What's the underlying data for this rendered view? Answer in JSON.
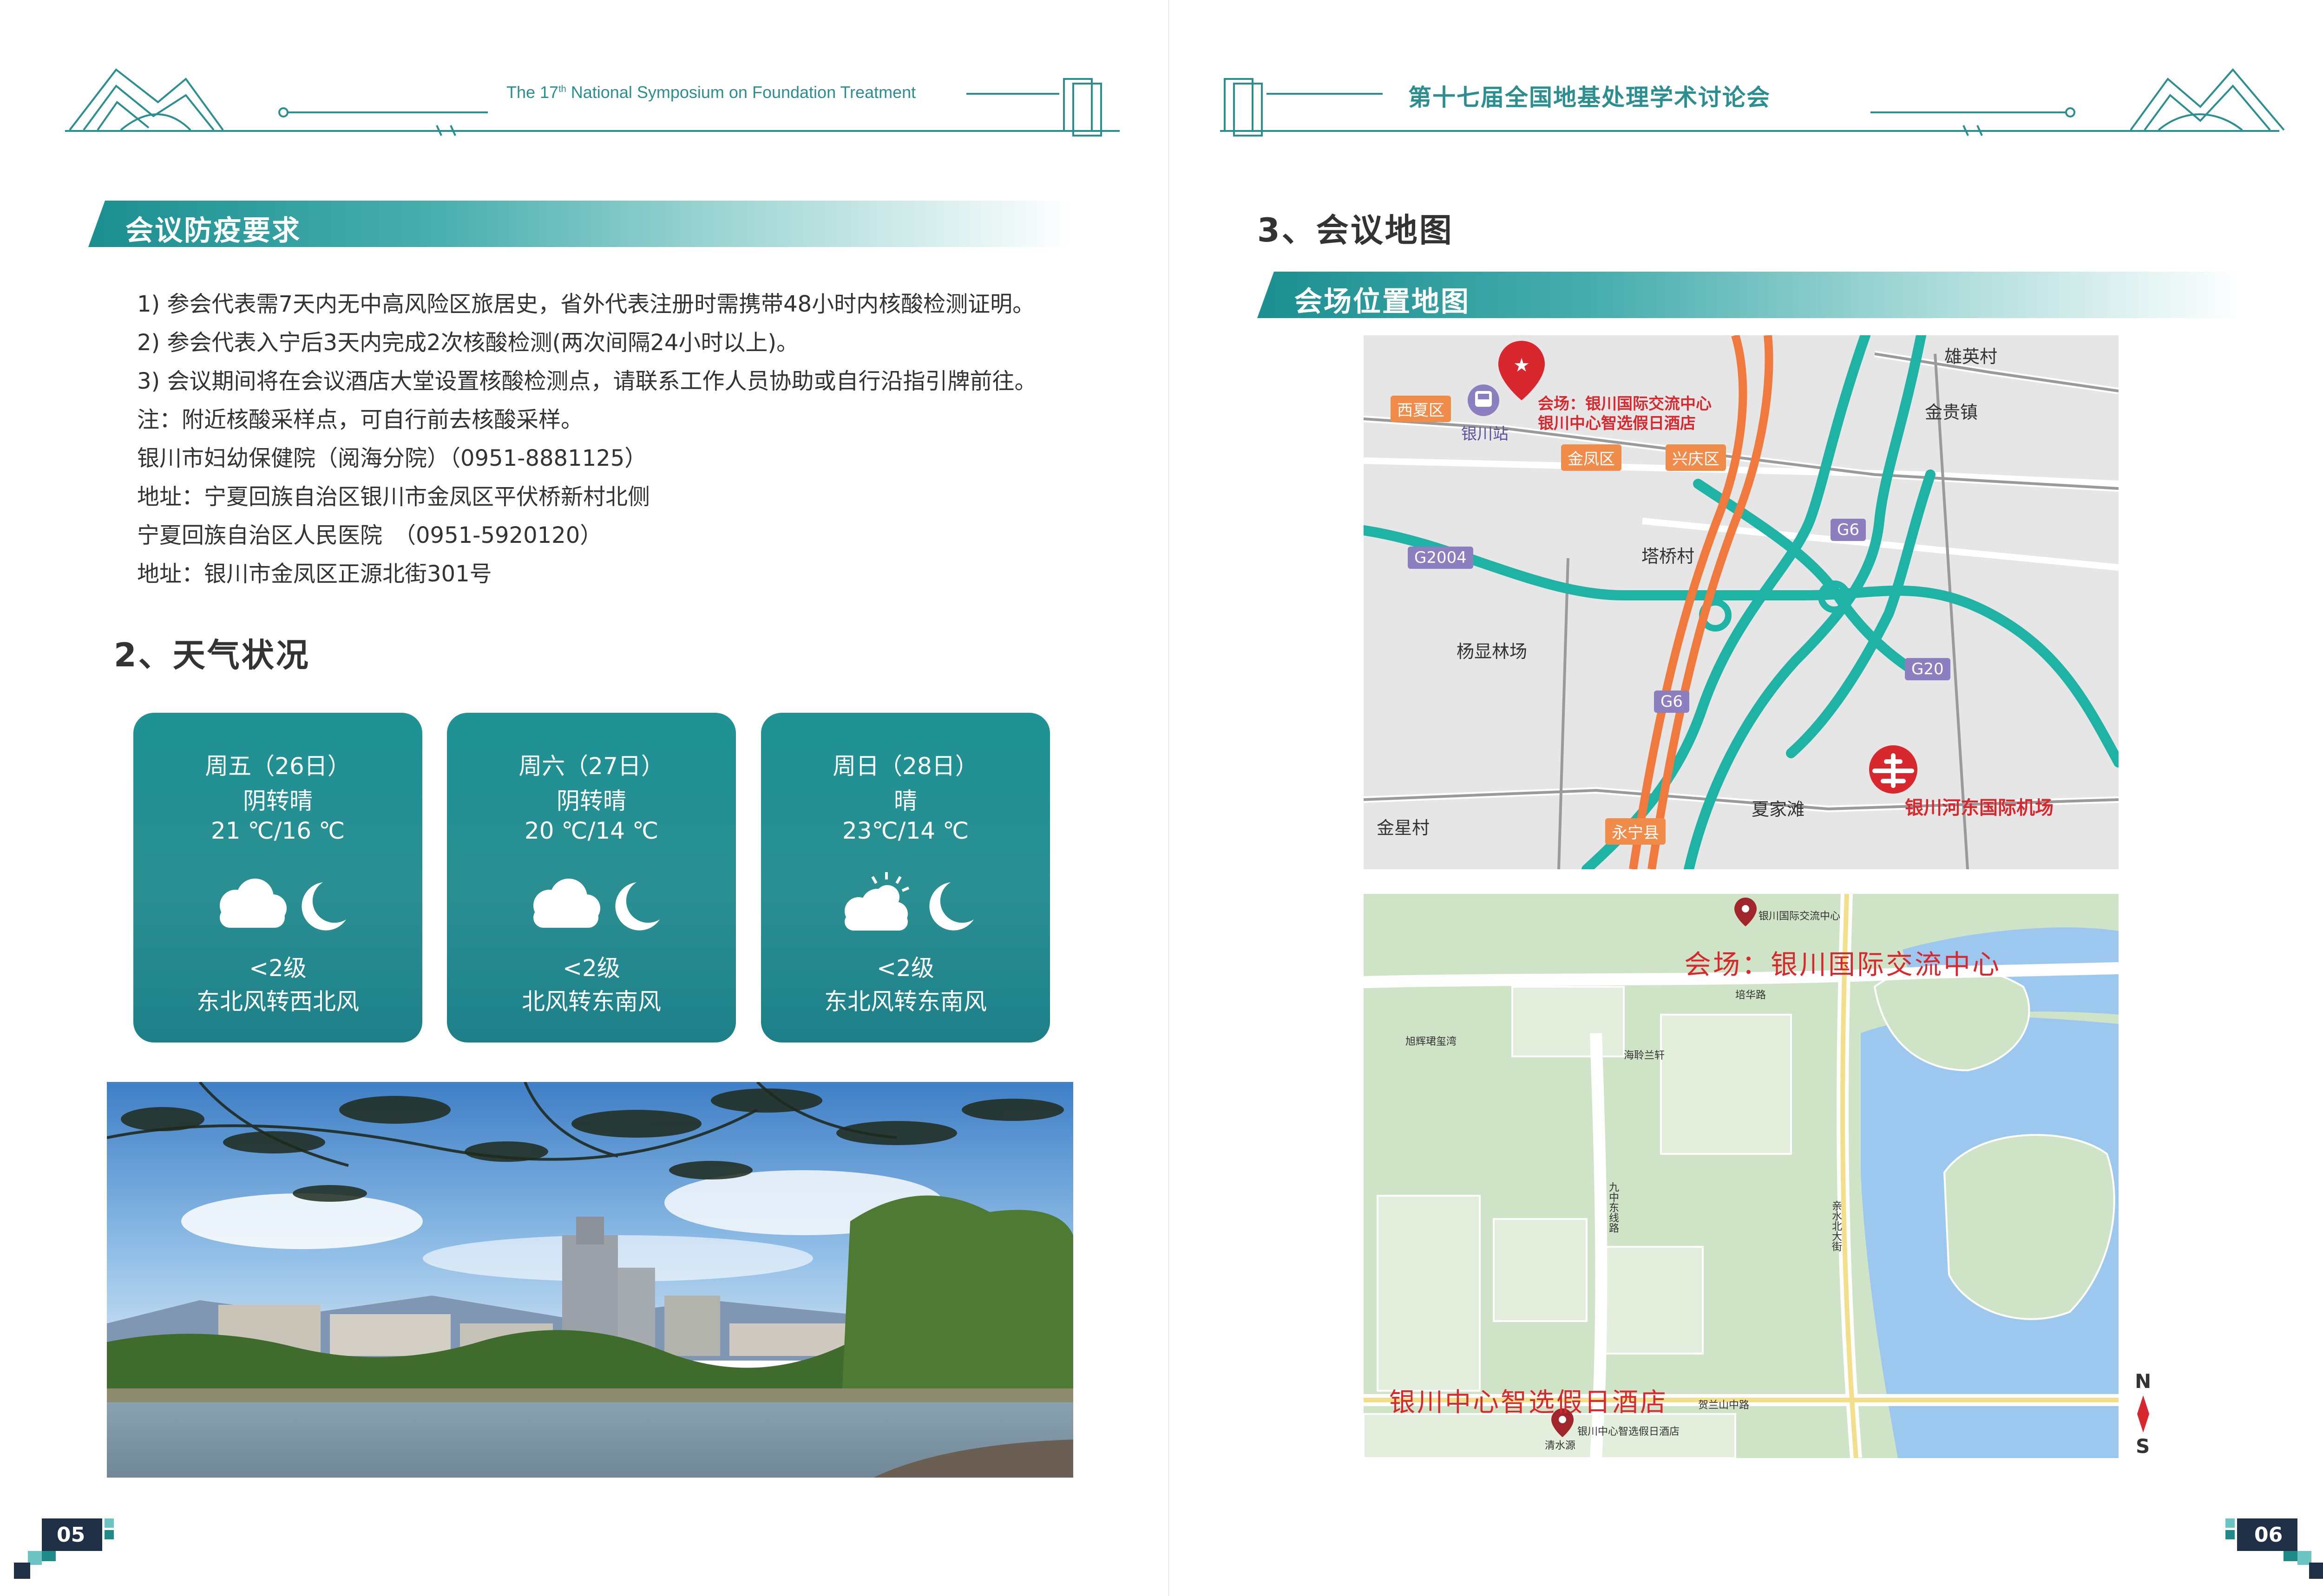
{
  "left_page": {
    "header_en_pre": "The 17",
    "header_en_sup": "th",
    "header_en_post": " National Symposium on Foundation Treatment",
    "section_title": "会议防疫要求",
    "lines": [
      "1) 参会代表需7天内无中高风险区旅居史，省外代表注册时需携带48小时内核酸检测证明。",
      "2) 参会代表入宁后3天内完成2次核酸检测(两次间隔24小时以上)。",
      "3) 会议期间将在会议酒店大堂设置核酸检测点，请联系工作人员协助或自行沿指引牌前往。",
      "注：附近核酸采样点，可自行前去核酸采样。",
      "银川市妇幼保健院（阅海分院）（0951-8881125）",
      "地址：宁夏回族自治区银川市金凤区平伏桥新村北侧",
      "宁夏回族自治区人民医院　（0951-5920120）",
      "地址：银川市金凤区正源北街301号"
    ],
    "weather_heading": "2、天气状况",
    "weather": [
      {
        "day": "周五（26日）",
        "cond": "阴转晴",
        "temp": "21 ℃/16 ℃",
        "level": "<2级",
        "wind": "东北风转西北风",
        "icon_day": "cloud-icon",
        "icon_night": "moon-icon"
      },
      {
        "day": "周六（27日）",
        "cond": "阴转晴",
        "temp": "20 ℃/14 ℃",
        "level": "<2级",
        "wind": "北风转东南风",
        "icon_day": "cloud-icon",
        "icon_night": "moon-icon"
      },
      {
        "day": "周日（28日）",
        "cond": "晴",
        "temp": "23℃/14 ℃",
        "level": "<2级",
        "wind": "东北风转东南风",
        "icon_day": "sun-cloud-icon",
        "icon_night": "moon-icon"
      }
    ],
    "page_number": "05"
  },
  "right_page": {
    "header_zh": "第十七届全国地基处理学术讨论会",
    "heading": "3、会议地图",
    "section_title": "会场位置地图",
    "map1": {
      "venue_line1": "会场：银川国际交流中心",
      "venue_line2": "银川中心智选假日酒店",
      "station": "银川站",
      "districts": [
        "西夏区",
        "金凤区",
        "兴庆区",
        "永宁县"
      ],
      "roads": [
        "G2004",
        "G6",
        "G6",
        "G20"
      ],
      "places": [
        "雄英村",
        "金贵镇",
        "塔桥村",
        "杨显林场",
        "夏家滩",
        "金星村"
      ],
      "airport": "银川河东国际机场"
    },
    "map2": {
      "venue_label": "会场：银川国际交流中心",
      "venue_small": "银川国际交流中心",
      "hotel_label": "银川中心智选假日酒店",
      "hotel_small": "银川中心智选假日酒店",
      "roads": [
        "培华路",
        "贺兰山中路",
        "九中东线路",
        "亲水北大街"
      ],
      "places": [
        "海聆兰轩",
        "旭辉珺玺湾",
        "清水源"
      ]
    },
    "compass_n": "N",
    "compass_s": "S",
    "page_number": "06"
  },
  "colors": {
    "teal": "#1f8a8a",
    "card": "#21908f",
    "red": "#d9272e",
    "orange": "#f08b4a",
    "road_teal": "#1fb3a6"
  }
}
